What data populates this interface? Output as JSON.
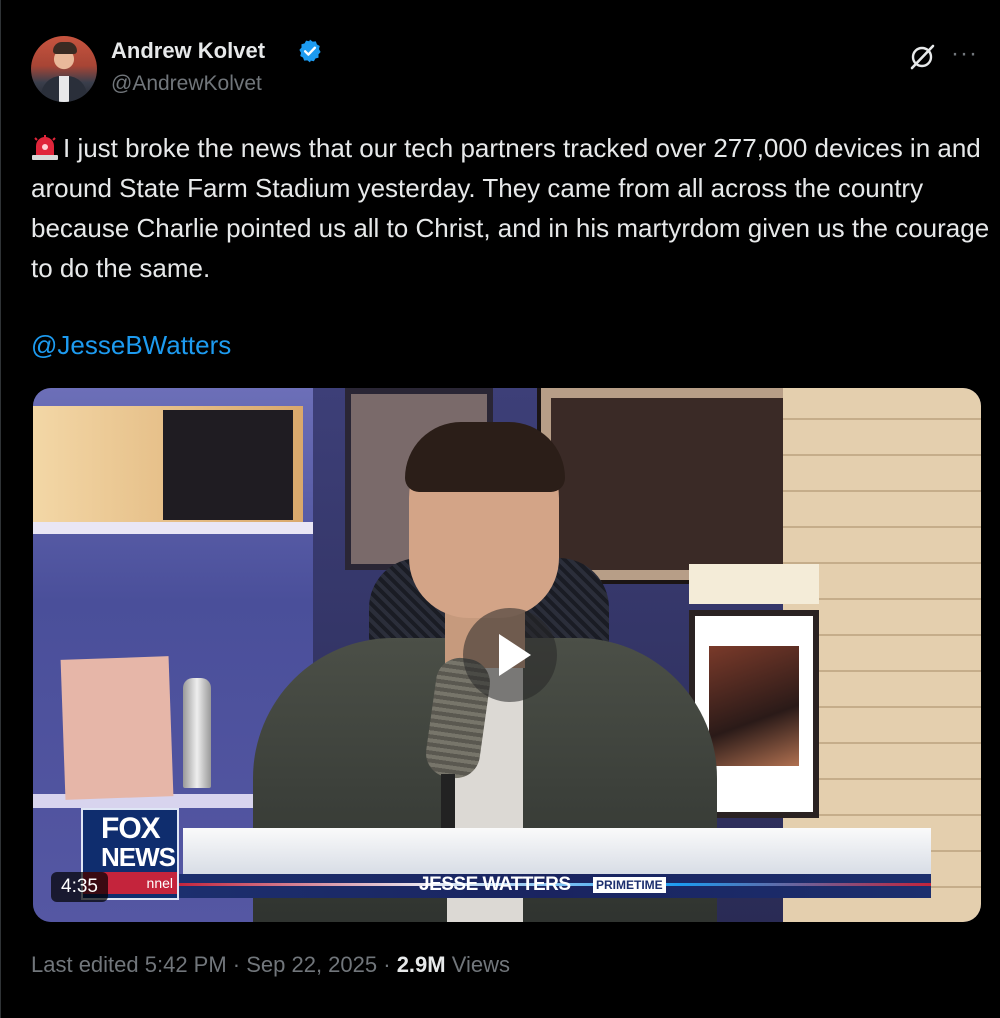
{
  "author": {
    "name": "Andrew Kolvet",
    "handle": "@AndrewKolvet",
    "verified": true,
    "verified_color": "#1d9bf0"
  },
  "tweet": {
    "text": "I just broke the news that our tech partners tracked over 277,000 devices in and around State Farm Stadium yesterday. They came from all across the country because Charlie pointed us all to Christ, and in his martyrdom given us the courage to do the same.",
    "leading_icon": "siren-icon",
    "mention": "@JesseBWatters"
  },
  "video": {
    "duration": "4:35",
    "logo_line1": "FOX",
    "logo_line2": "NEWS",
    "logo_line3": "nnel",
    "lower_third_title": "JESSE WATTERS",
    "lower_third_sub": "PRIMETIME"
  },
  "footer": {
    "edited": "Last edited 5:42 PM · Sep 22, 2025 · ",
    "views_count": "2.9M",
    "views_label": " Views"
  },
  "colors": {
    "background": "#000000",
    "text": "#e7e9ea",
    "muted": "#71767b",
    "link": "#1d9bf0"
  }
}
